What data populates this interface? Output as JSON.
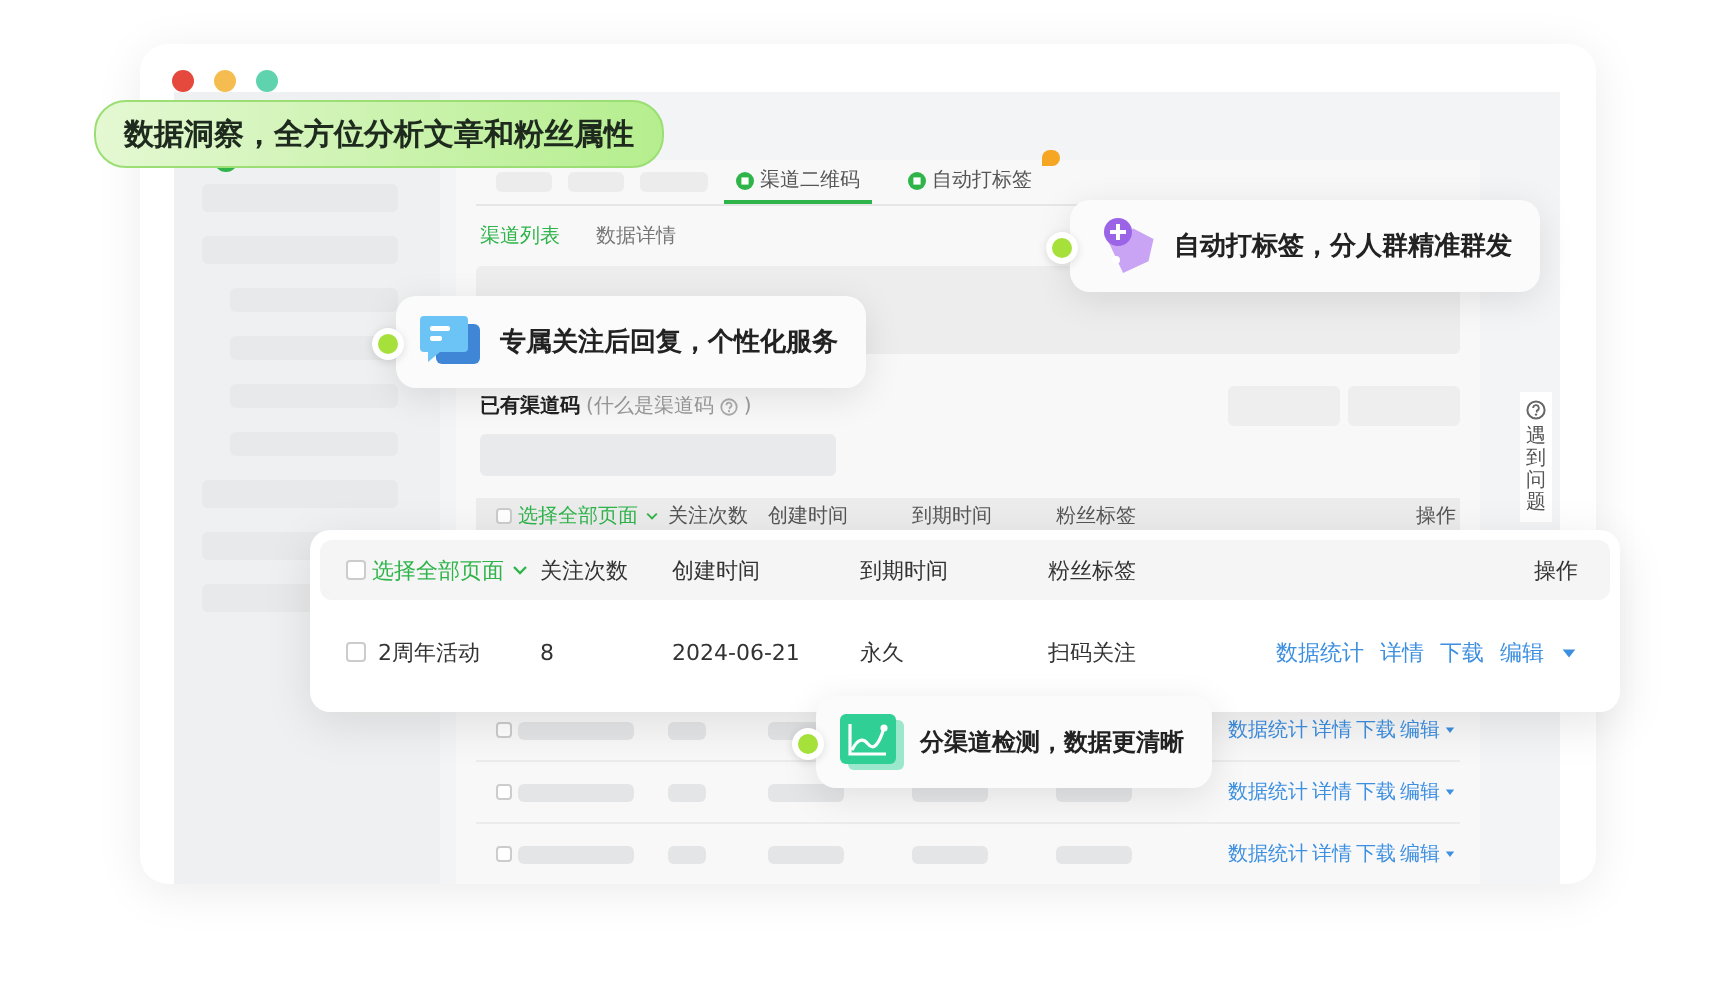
{
  "window": {
    "dots": [
      {
        "color": "#e5483c"
      },
      {
        "color": "#f5bd4f"
      },
      {
        "color": "#5ed3ae"
      }
    ]
  },
  "banner": {
    "text": "数据洞察，全方位分析文章和粉丝属性"
  },
  "tabs": [
    {
      "label": "渠道二维码",
      "selected": true,
      "new_badge": false
    },
    {
      "label": "自动打标签",
      "selected": false,
      "new_badge": true
    }
  ],
  "subtabs": [
    {
      "label": "渠道列表",
      "selected": true
    },
    {
      "label": "数据详情",
      "selected": false
    }
  ],
  "section": {
    "title": "已有渠道码",
    "hint": "(什么是渠道码",
    "hint_end": ")"
  },
  "table": {
    "select_all_checked": false,
    "columns": [
      "选择全部页面",
      "关注次数",
      "创建时间",
      "到期时间",
      "粉丝标签",
      "操作"
    ],
    "rows": [
      {
        "checked": false,
        "actions": [
          "数据统计",
          "详情",
          "下载",
          "编辑"
        ]
      },
      {
        "checked": false,
        "actions": [
          "数据统计",
          "详情",
          "下载",
          "编辑"
        ]
      },
      {
        "checked": false,
        "actions": [
          "数据统计",
          "详情",
          "下载",
          "编辑"
        ]
      }
    ]
  },
  "card_table": {
    "select_all_checked": false,
    "columns": [
      "选择全部页面",
      "关注次数",
      "创建时间",
      "到期时间",
      "粉丝标签",
      "操作"
    ],
    "rows": [
      {
        "checked": false,
        "cells": [
          "2周年活动",
          "8",
          "2024-06-21",
          "永久",
          "扫码关注"
        ],
        "actions": [
          "数据统计",
          "详情",
          "下载",
          "编辑"
        ]
      }
    ]
  },
  "callouts": [
    {
      "kind": "chat",
      "text": "专属关注后回复，个性化服务"
    },
    {
      "kind": "tag",
      "text": "自动打标签，分人群精准群发"
    },
    {
      "kind": "chart",
      "text": "分渠道检测，数据更清晰"
    }
  ],
  "help": {
    "text": "遇到问题"
  }
}
